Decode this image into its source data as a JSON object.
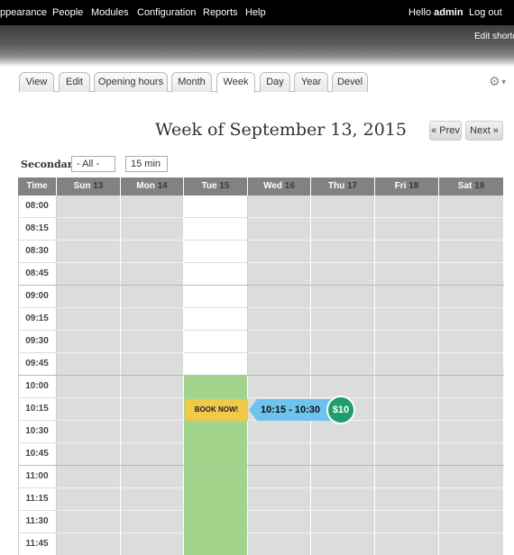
{
  "admin_bar": {
    "items": [
      "ppearance",
      "People",
      "Modules",
      "Configuration",
      "Reports",
      "Help"
    ],
    "hello_text": "Hello",
    "username": "admin",
    "logout": "Log out"
  },
  "shortcut_bar": {
    "edit_shortcuts": "Edit shortco"
  },
  "tabs": [
    "View",
    "Edit",
    "Opening hours",
    "Month",
    "Week",
    "Day",
    "Year",
    "Devel"
  ],
  "active_tab": "Week",
  "heading": "Week of September 13, 2015",
  "pager": {
    "prev": "« Prev",
    "next": "Next »"
  },
  "filters": {
    "label": "Secondary",
    "secondary_value": "- All -",
    "interval_value": "15 min"
  },
  "calendar": {
    "time_header": "Time",
    "days": [
      {
        "name": "Sun",
        "num": "13"
      },
      {
        "name": "Mon",
        "num": "14"
      },
      {
        "name": "Tue",
        "num": "15"
      },
      {
        "name": "Wed",
        "num": "16"
      },
      {
        "name": "Thu",
        "num": "17"
      },
      {
        "name": "Fri",
        "num": "18"
      },
      {
        "name": "Sat",
        "num": "19"
      }
    ],
    "times": [
      "08:00",
      "08:15",
      "08:30",
      "08:45",
      "09:00",
      "09:15",
      "09:30",
      "09:45",
      "10:00",
      "10:15",
      "10:30",
      "10:45",
      "11:00",
      "11:15",
      "11:30",
      "11:45"
    ]
  },
  "booking": {
    "book_now": "BOOK NOW!",
    "time_range": "10:15 - 10:30",
    "price": "$10"
  },
  "colors": {
    "booked": "#a2d48c",
    "book_now": "#f0c84a",
    "bubble": "#6dc3ec",
    "price": "#1f9d6c"
  }
}
